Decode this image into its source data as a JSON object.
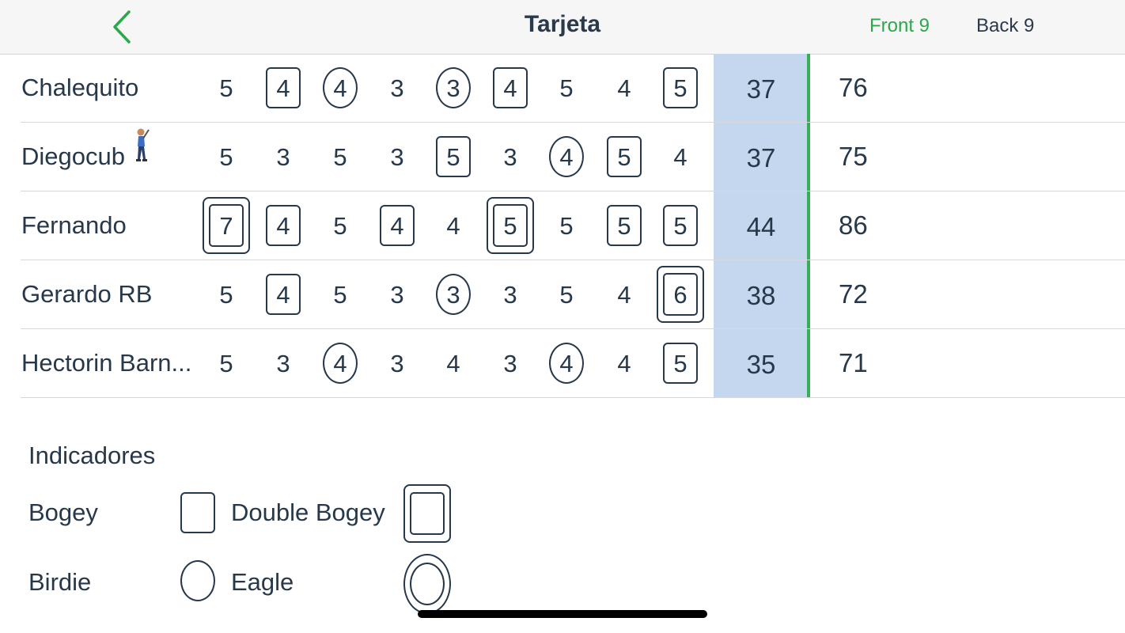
{
  "header": {
    "title": "Tarjeta",
    "back_icon": "chevron-left-icon",
    "segments": [
      "Front 9",
      "Back 9"
    ],
    "active_segment": "Front 9",
    "accent_color": "#2aa84a"
  },
  "players": [
    {
      "name": "Chalequito",
      "scores": [
        {
          "v": "5",
          "m": "none"
        },
        {
          "v": "4",
          "m": "box"
        },
        {
          "v": "4",
          "m": "circle"
        },
        {
          "v": "3",
          "m": "none"
        },
        {
          "v": "3",
          "m": "circle"
        },
        {
          "v": "4",
          "m": "box"
        },
        {
          "v": "5",
          "m": "none"
        },
        {
          "v": "4",
          "m": "none"
        },
        {
          "v": "5",
          "m": "box"
        }
      ],
      "out": "37",
      "total": "76"
    },
    {
      "name": "Diegocub",
      "icon": "golfer-icon",
      "scores": [
        {
          "v": "5",
          "m": "none"
        },
        {
          "v": "3",
          "m": "none"
        },
        {
          "v": "5",
          "m": "none"
        },
        {
          "v": "3",
          "m": "none"
        },
        {
          "v": "5",
          "m": "box"
        },
        {
          "v": "3",
          "m": "none"
        },
        {
          "v": "4",
          "m": "circle"
        },
        {
          "v": "5",
          "m": "box"
        },
        {
          "v": "4",
          "m": "none"
        }
      ],
      "out": "37",
      "total": "75"
    },
    {
      "name": "Fernando",
      "scores": [
        {
          "v": "7",
          "m": "double-box"
        },
        {
          "v": "4",
          "m": "box"
        },
        {
          "v": "5",
          "m": "none"
        },
        {
          "v": "4",
          "m": "box"
        },
        {
          "v": "4",
          "m": "none"
        },
        {
          "v": "5",
          "m": "double-box"
        },
        {
          "v": "5",
          "m": "none"
        },
        {
          "v": "5",
          "m": "box"
        },
        {
          "v": "5",
          "m": "box"
        }
      ],
      "out": "44",
      "total": "86"
    },
    {
      "name": "Gerardo RB",
      "scores": [
        {
          "v": "5",
          "m": "none"
        },
        {
          "v": "4",
          "m": "box"
        },
        {
          "v": "5",
          "m": "none"
        },
        {
          "v": "3",
          "m": "none"
        },
        {
          "v": "3",
          "m": "circle"
        },
        {
          "v": "3",
          "m": "none"
        },
        {
          "v": "5",
          "m": "none"
        },
        {
          "v": "4",
          "m": "none"
        },
        {
          "v": "6",
          "m": "double-box"
        }
      ],
      "out": "38",
      "total": "72"
    },
    {
      "name": "Hectorin  Barn...",
      "scores": [
        {
          "v": "5",
          "m": "none"
        },
        {
          "v": "3",
          "m": "none"
        },
        {
          "v": "4",
          "m": "circle"
        },
        {
          "v": "3",
          "m": "none"
        },
        {
          "v": "4",
          "m": "none"
        },
        {
          "v": "3",
          "m": "none"
        },
        {
          "v": "4",
          "m": "circle"
        },
        {
          "v": "4",
          "m": "none"
        },
        {
          "v": "5",
          "m": "box"
        }
      ],
      "out": "35",
      "total": "71"
    }
  ],
  "legend": {
    "title": "Indicadores",
    "bogey": "Bogey",
    "double_bogey": "Double Bogey",
    "birdie": "Birdie",
    "eagle": "Eagle"
  }
}
